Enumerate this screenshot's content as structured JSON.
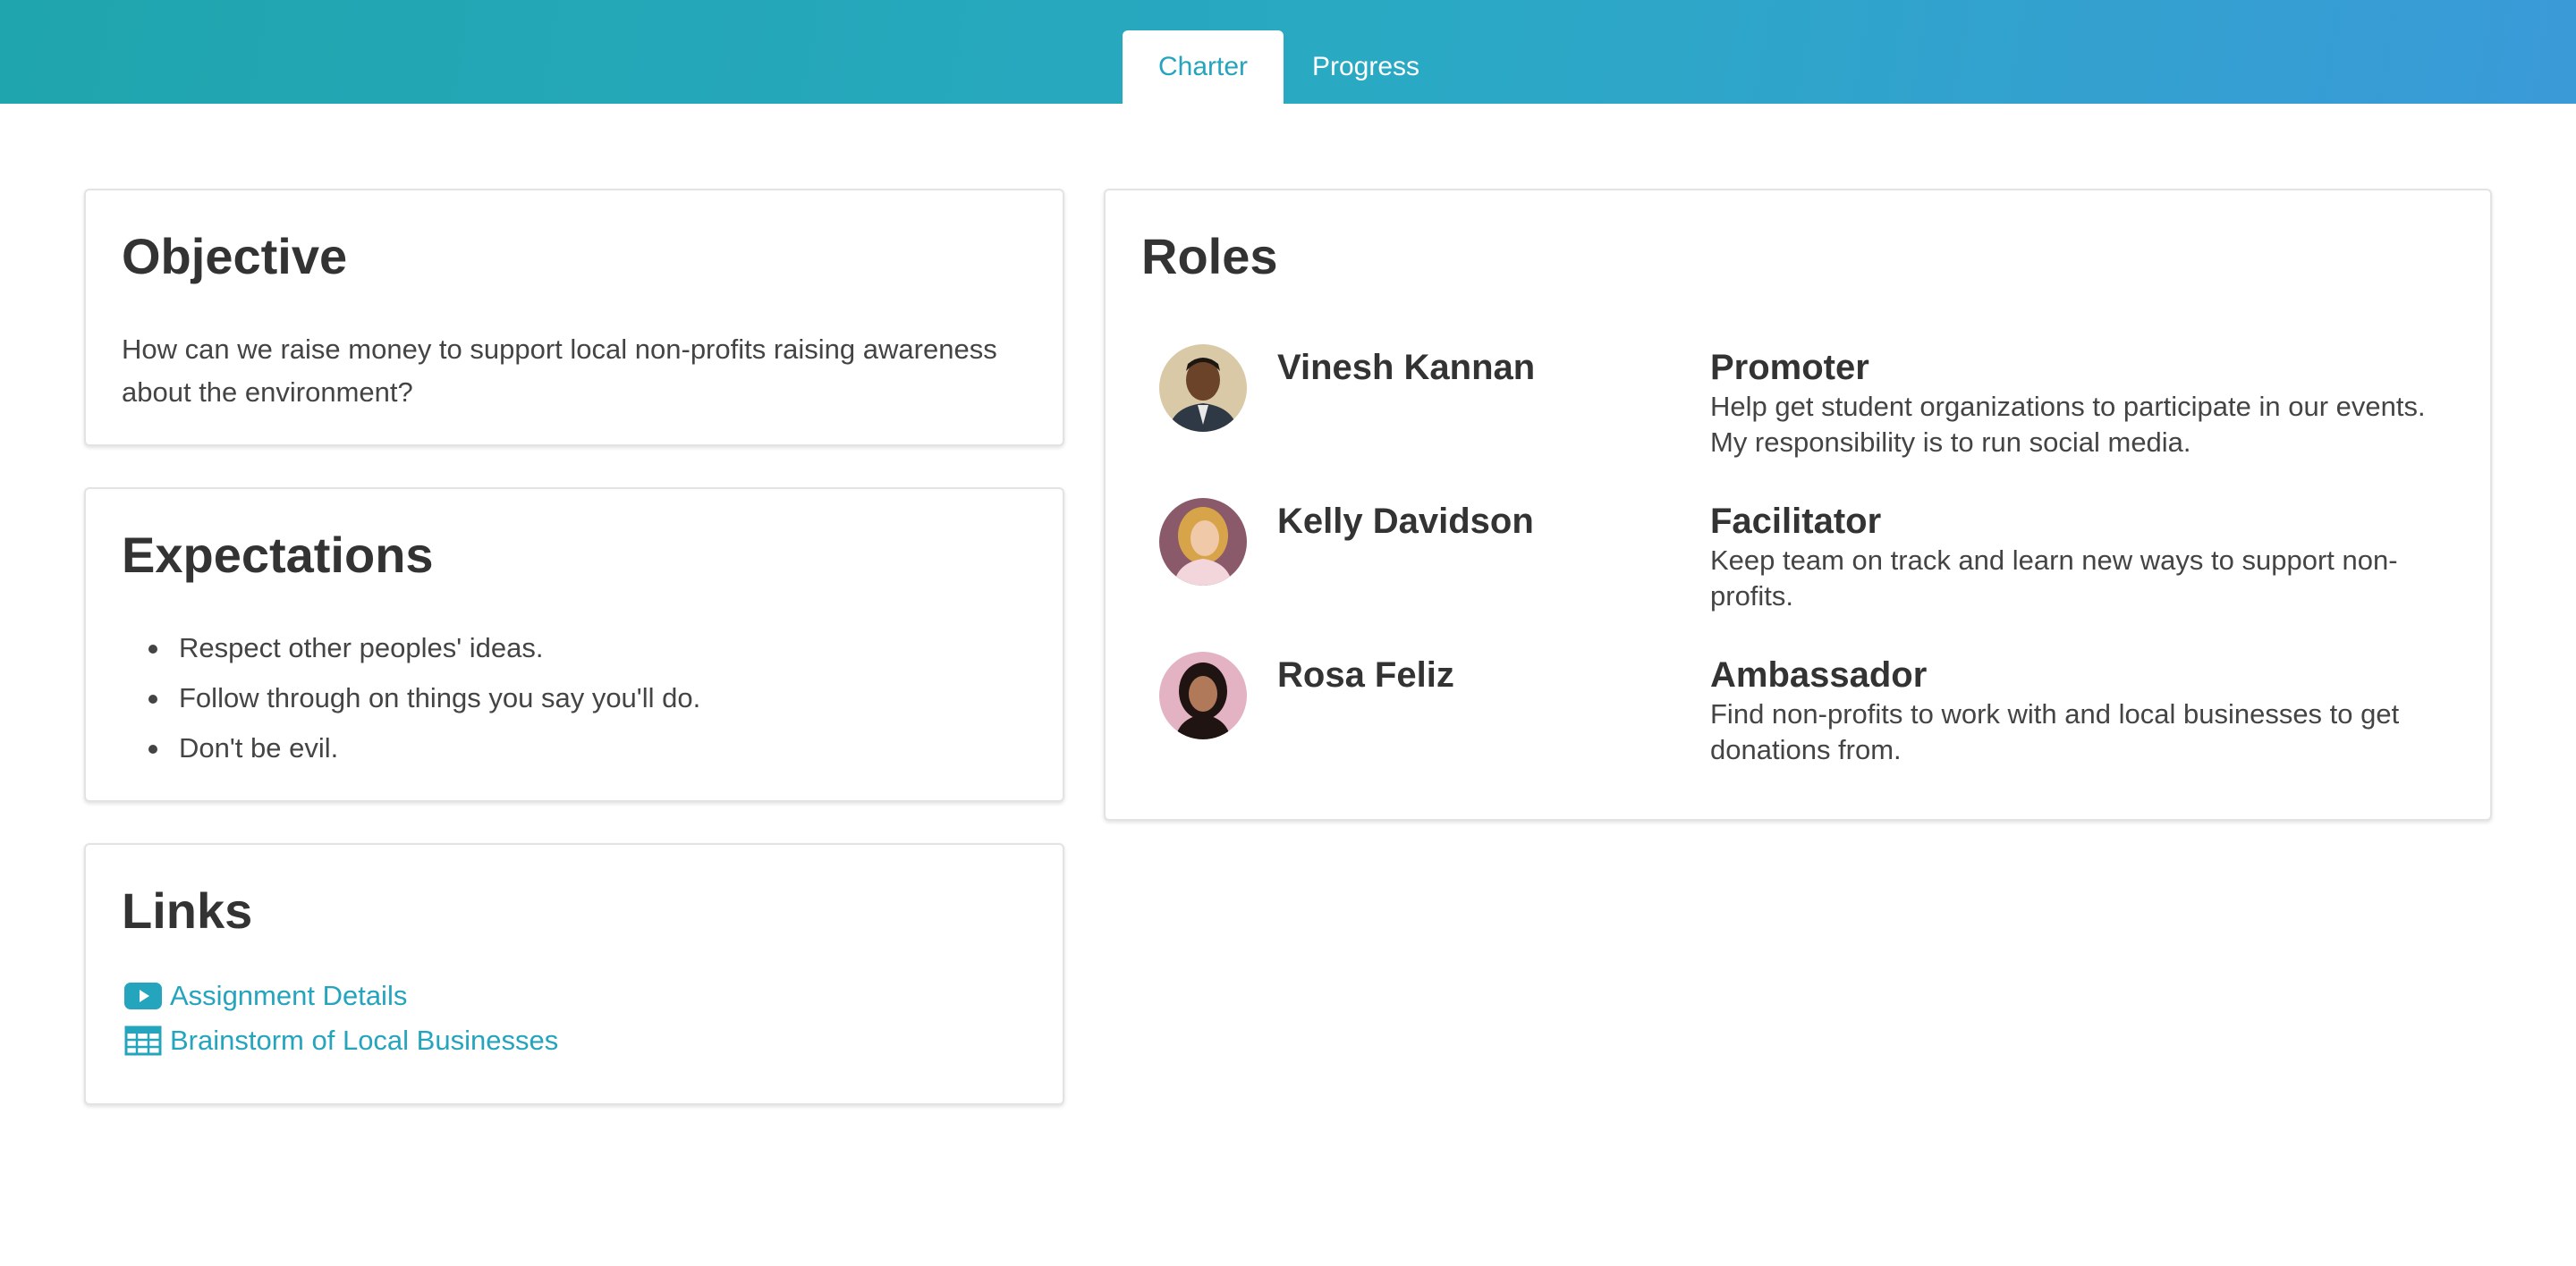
{
  "tabs": [
    {
      "label": "Charter",
      "active": true
    },
    {
      "label": "Progress",
      "active": false
    }
  ],
  "objective": {
    "heading": "Objective",
    "text": "How can we raise money to support local non-profits raising awareness about the environment?"
  },
  "expectations": {
    "heading": "Expectations",
    "items": [
      "Respect other peoples' ideas.",
      "Follow through on things you say you'll do.",
      "Don't be evil."
    ]
  },
  "links": {
    "heading": "Links",
    "items": [
      {
        "label": "Assignment Details",
        "icon": "video-icon"
      },
      {
        "label": "Brainstorm of Local Businesses",
        "icon": "table-icon"
      }
    ]
  },
  "roles": {
    "heading": "Roles",
    "members": [
      {
        "name": "Vinesh Kannan",
        "role": "Promoter",
        "description": "Help get student organizations to participate in our events. My responsibility is to run social media."
      },
      {
        "name": "Kelly Davidson",
        "role": "Facilitator",
        "description": "Keep team on track and learn new ways to support non-profits."
      },
      {
        "name": "Rosa Feliz",
        "role": "Ambassador",
        "description": "Find non-profits to work with and local businesses to get donations from."
      }
    ]
  },
  "colors": {
    "accent": "#24a4bd",
    "header_start": "#1fa5ad",
    "header_end": "#3a9ad8"
  }
}
